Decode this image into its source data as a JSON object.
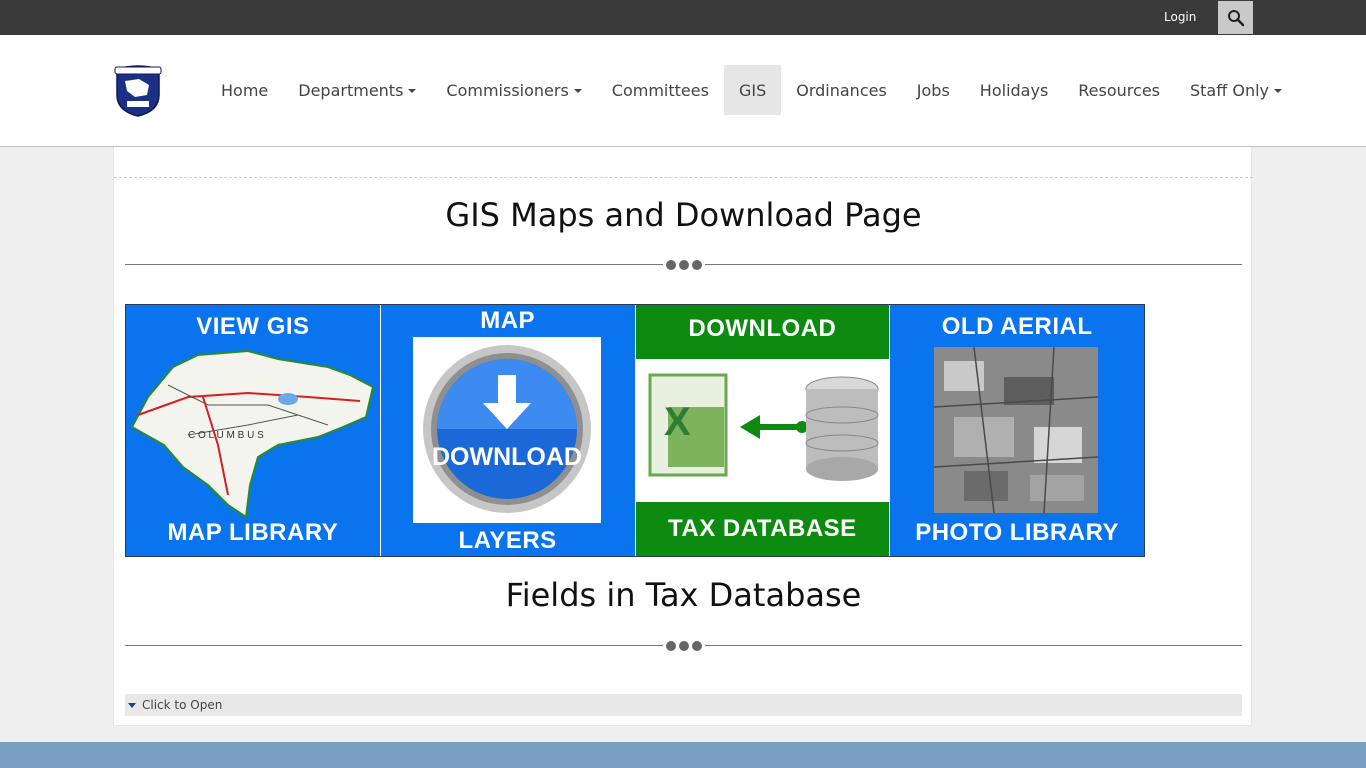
{
  "topbar": {
    "login_label": "Login"
  },
  "nav": {
    "items": [
      {
        "label": "Home",
        "dropdown": false
      },
      {
        "label": "Departments",
        "dropdown": true
      },
      {
        "label": "Commissioners",
        "dropdown": true
      },
      {
        "label": "Committees",
        "dropdown": false
      },
      {
        "label": "GIS",
        "dropdown": false,
        "active": true
      },
      {
        "label": "Ordinances",
        "dropdown": false
      },
      {
        "label": "Jobs",
        "dropdown": false
      },
      {
        "label": "Holidays",
        "dropdown": false
      },
      {
        "label": "Resources",
        "dropdown": false
      },
      {
        "label": "Staff Only",
        "dropdown": true
      }
    ]
  },
  "main": {
    "title": "GIS Maps and Download Page",
    "tiles": [
      {
        "top": "VIEW   GIS",
        "bottom": "MAP LIBRARY",
        "color": "#0a74ee"
      },
      {
        "top": "MAP",
        "center": "DOWNLOAD",
        "bottom": "LAYERS",
        "color": "#0a74ee"
      },
      {
        "top": "DOWNLOAD",
        "bottom": "TAX DATABASE",
        "color": "#0d8a10"
      },
      {
        "top": "OLD AERIAL",
        "bottom": "PHOTO LIBRARY",
        "color": "#0a74ee"
      }
    ],
    "subtitle": "Fields in Tax Database",
    "accordion_label": "Click to Open"
  },
  "colors": {
    "topbar": "#3a3a3a",
    "footer": "#7a9fc3",
    "active_nav": "#e6e6e6"
  }
}
